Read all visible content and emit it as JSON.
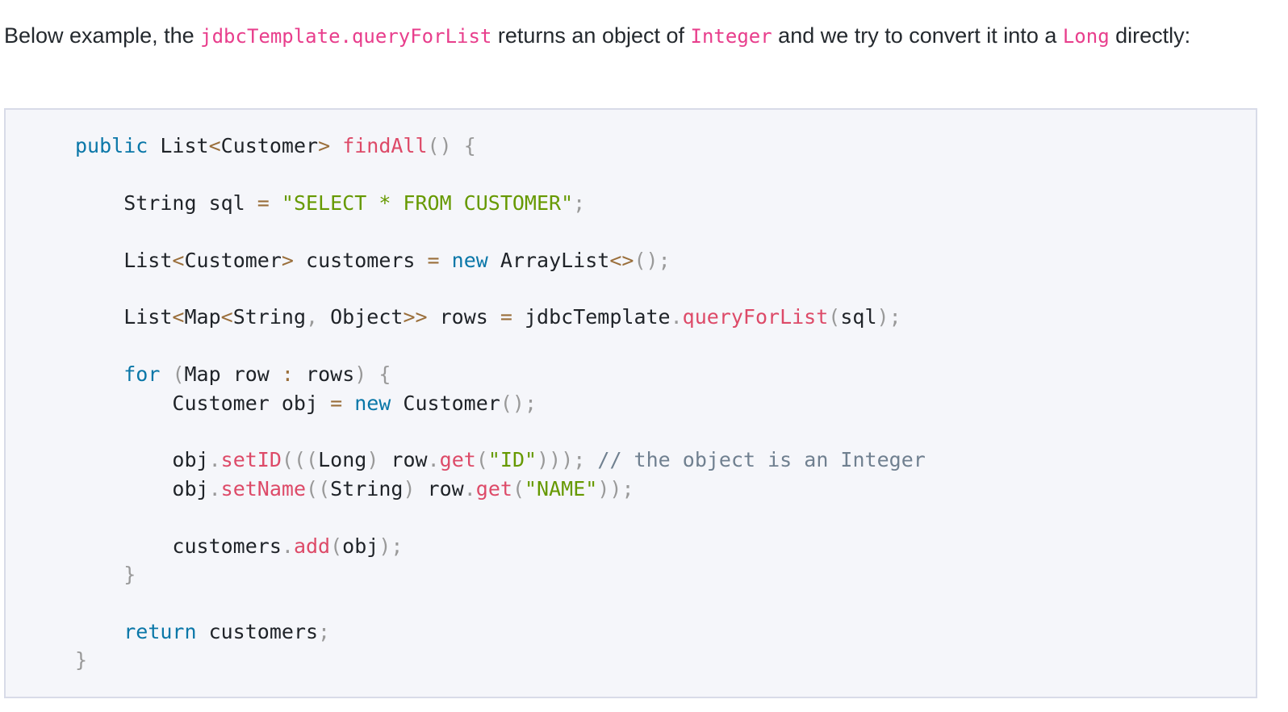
{
  "intro": {
    "text_1": "Below example, the ",
    "code_1": "jdbcTemplate.queryForList",
    "text_2": " returns an object of ",
    "code_2": "Integer",
    "text_3": " and we try to convert it into a ",
    "code_3": "Long",
    "text_4": " directly:"
  },
  "code_block": {
    "language": "java",
    "lines": [
      "public List<Customer> findAll() {",
      "",
      "    String sql = \"SELECT * FROM CUSTOMER\";",
      "",
      "    List<Customer> customers = new ArrayList<>();",
      "",
      "    List<Map<String, Object>> rows = jdbcTemplate.queryForList(sql);",
      "",
      "    for (Map row : rows) {",
      "        Customer obj = new Customer();",
      "",
      "        obj.setID(((Long) row.get(\"ID\"))); // the object is an Integer",
      "        obj.setName((String) row.get(\"NAME\"));",
      "",
      "        customers.add(obj);",
      "    }",
      "",
      "    return customers;",
      "}"
    ]
  },
  "syntax_colors": {
    "keyword": "#0a77a8",
    "function": "#dd4a68",
    "string": "#669900",
    "operator": "#9a6e3a",
    "punctuation": "#999999",
    "comment": "#708090",
    "inline_code": "#e83e8c",
    "code_background": "#f5f6fa"
  }
}
